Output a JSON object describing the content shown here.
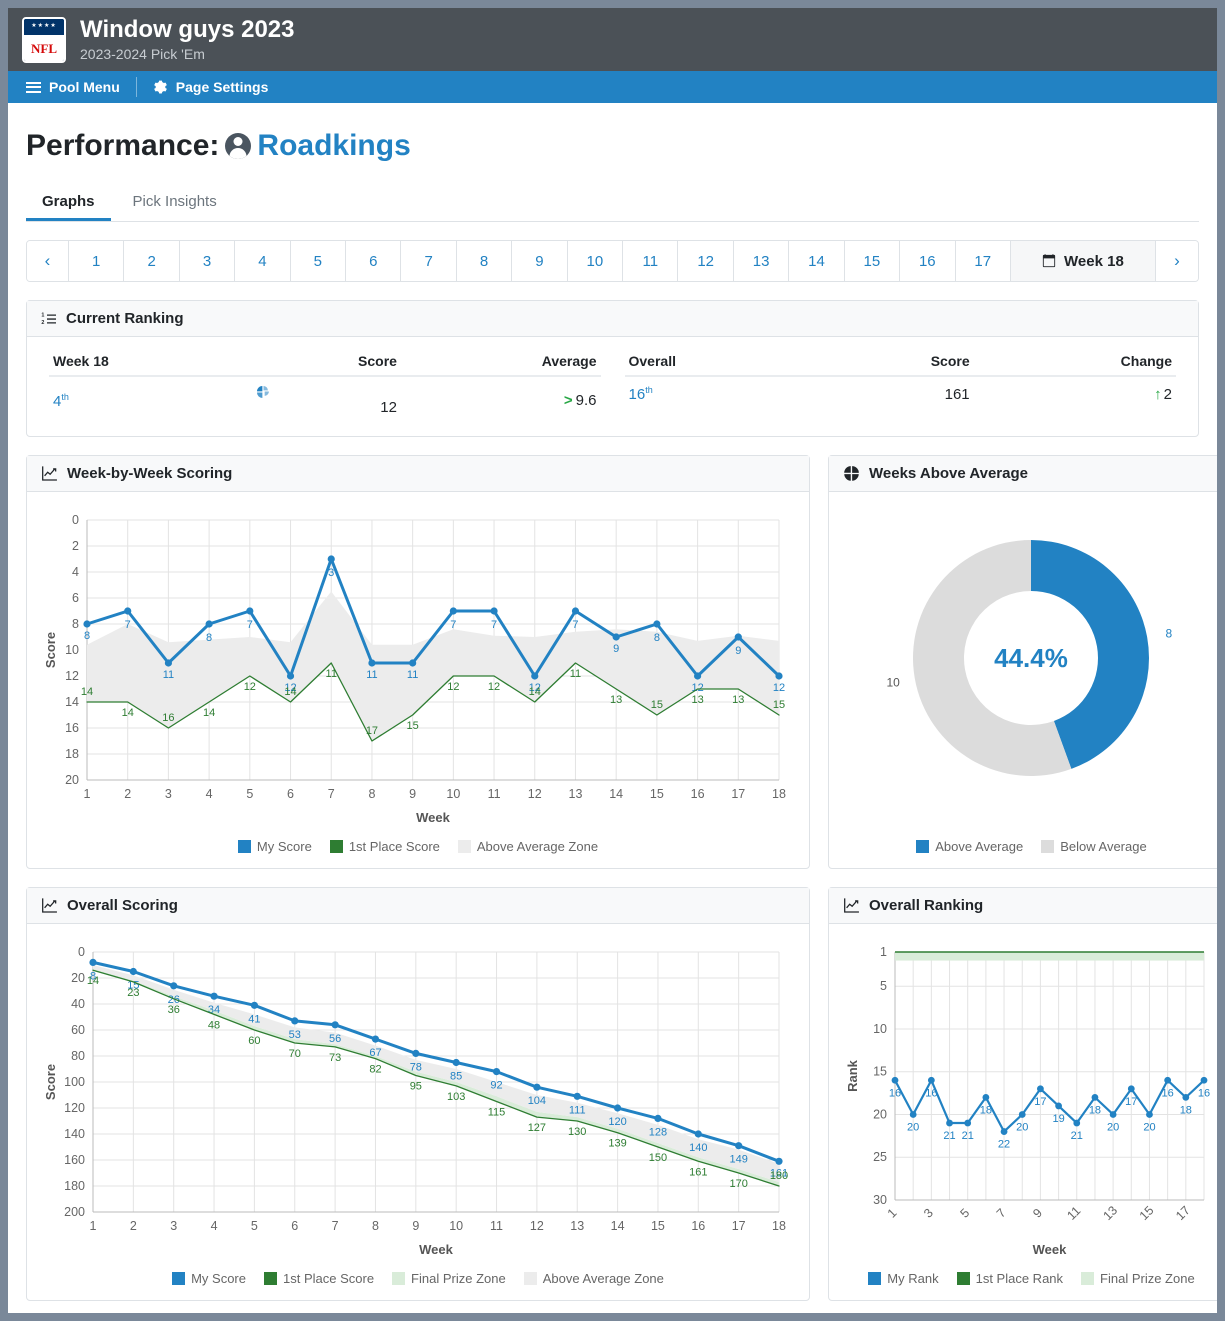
{
  "header": {
    "logo_alt": "NFL",
    "logo_stars": "★★★★",
    "logo_text": "NFL",
    "title": "Window guys 2023",
    "subtitle": "2023-2024 Pick 'Em",
    "menu": {
      "pool_menu": "Pool Menu",
      "page_settings": "Page Settings"
    }
  },
  "page": {
    "heading_prefix": "Performance:",
    "username": "Roadkings"
  },
  "tabs": [
    {
      "label": "Graphs",
      "active": true
    },
    {
      "label": "Pick Insights",
      "active": false
    }
  ],
  "pager": {
    "prev": "‹",
    "next": "›",
    "weeks": [
      "1",
      "2",
      "3",
      "4",
      "5",
      "6",
      "7",
      "8",
      "9",
      "10",
      "11",
      "12",
      "13",
      "14",
      "15",
      "16",
      "17"
    ],
    "current": "Week 18"
  },
  "current_ranking": {
    "panel_title": "Current Ranking",
    "left": {
      "header_label": "Week 18",
      "header_score": "Score",
      "header_average": "Average",
      "rank": "4",
      "rank_suffix": "th",
      "score": "12",
      "average": "9.6"
    },
    "right": {
      "header_label": "Overall",
      "header_score": "Score",
      "header_change": "Change",
      "rank": "16",
      "rank_suffix": "th",
      "score": "161",
      "change": "2",
      "change_direction": "up"
    }
  },
  "panels": {
    "week_by_week": "Week-by-Week Scoring",
    "weeks_above_average": "Weeks Above Average",
    "overall_scoring": "Overall Scoring",
    "overall_ranking": "Overall Ranking"
  },
  "colors": {
    "blue": "#2282c3",
    "green": "#2e7d32",
    "green_zone": "#d9ecd9",
    "gray_zone": "#ececec",
    "donut_gray": "#dcdcdc",
    "nav_blue": "#2282c3"
  },
  "chart_data": [
    {
      "id": "week_by_week",
      "type": "line",
      "title": "Week-by-Week Scoring",
      "xlabel": "Week",
      "ylabel": "Score",
      "xlim": [
        1,
        18
      ],
      "ylim": [
        0,
        20
      ],
      "yticks": [
        0,
        2,
        4,
        6,
        8,
        10,
        12,
        14,
        16,
        18,
        20
      ],
      "categories": [
        1,
        2,
        3,
        4,
        5,
        6,
        7,
        8,
        9,
        10,
        11,
        12,
        13,
        14,
        15,
        16,
        17,
        18
      ],
      "grid": true,
      "legend_position": "bottom",
      "series": [
        {
          "name": "My Score",
          "color": "#2282c3",
          "values": [
            8,
            7,
            11,
            8,
            7,
            12,
            3,
            11,
            11,
            7,
            7,
            12,
            7,
            9,
            8,
            12,
            9,
            12
          ]
        },
        {
          "name": "1st Place Score",
          "color": "#2e7d32",
          "values": [
            14,
            14,
            16,
            14,
            12,
            14,
            11,
            17,
            15,
            12,
            12,
            14,
            11,
            13,
            15,
            13,
            13,
            15
          ]
        },
        {
          "name": "Above Average Zone",
          "color": "#ececec",
          "kind": "band",
          "values": [
            9.6,
            8,
            9.4,
            9.2,
            9.0,
            9.4,
            5.5,
            9.6,
            9.6,
            8.4,
            8.9,
            9.0,
            8.6,
            8.4,
            8.6,
            9.3,
            8.9,
            9.3
          ]
        }
      ]
    },
    {
      "id": "weeks_above_average",
      "type": "pie",
      "title": "Weeks Above Average",
      "center_label": "44.4%",
      "legend_position": "bottom",
      "labels": [
        "Above Average",
        "Below Average"
      ],
      "values": [
        8,
        10
      ],
      "colors": [
        "#2282c3",
        "#dcdcdc"
      ]
    },
    {
      "id": "overall_scoring",
      "type": "line",
      "title": "Overall Scoring",
      "xlabel": "Week",
      "ylabel": "Score",
      "xlim": [
        1,
        18
      ],
      "ylim": [
        0,
        200
      ],
      "yticks": [
        0,
        20,
        40,
        60,
        80,
        100,
        120,
        140,
        160,
        180,
        200
      ],
      "categories": [
        1,
        2,
        3,
        4,
        5,
        6,
        7,
        8,
        9,
        10,
        11,
        12,
        13,
        14,
        15,
        16,
        17,
        18
      ],
      "grid": true,
      "legend_position": "bottom",
      "series": [
        {
          "name": "My Score",
          "color": "#2282c3",
          "values": [
            8,
            15,
            26,
            34,
            41,
            53,
            56,
            67,
            78,
            85,
            92,
            104,
            111,
            120,
            128,
            140,
            149,
            161
          ]
        },
        {
          "name": "1st Place Score",
          "color": "#2e7d32",
          "values": [
            14,
            23,
            36,
            48,
            60,
            70,
            73,
            82,
            95,
            103,
            115,
            127,
            130,
            139,
            150,
            161,
            170,
            180
          ]
        },
        {
          "name": "Final Prize Zone",
          "color": "#d9ecd9",
          "kind": "band",
          "values": [
            13,
            22,
            34,
            45,
            57,
            67,
            71,
            80,
            92,
            100,
            111,
            123,
            127,
            136,
            147,
            158,
            167,
            177
          ]
        },
        {
          "name": "Above Average Zone",
          "color": "#ececec",
          "kind": "band",
          "values": [
            10,
            18,
            29,
            39,
            48,
            58,
            62,
            72,
            83,
            90,
            100,
            110,
            116,
            124,
            133,
            144,
            152,
            163
          ]
        }
      ]
    },
    {
      "id": "overall_ranking",
      "type": "line",
      "title": "Overall Ranking",
      "xlabel": "Week",
      "ylabel": "Rank",
      "xlim": [
        1,
        18
      ],
      "ylim": [
        30,
        1
      ],
      "yticks": [
        1,
        5,
        10,
        15,
        20,
        25,
        30
      ],
      "xticks": [
        1,
        3,
        5,
        7,
        9,
        11,
        13,
        15,
        17
      ],
      "categories": [
        1,
        2,
        3,
        4,
        5,
        6,
        7,
        8,
        9,
        10,
        11,
        12,
        13,
        14,
        15,
        16,
        17,
        18
      ],
      "grid": true,
      "legend_position": "bottom",
      "series": [
        {
          "name": "My Rank",
          "color": "#2282c3",
          "values": [
            16,
            20,
            16,
            21,
            21,
            18,
            22,
            20,
            17,
            19,
            21,
            18,
            20,
            17,
            20,
            16,
            18,
            16
          ]
        },
        {
          "name": "1st Place Rank",
          "color": "#2e7d32",
          "values": [
            1,
            1,
            1,
            1,
            1,
            1,
            1,
            1,
            1,
            1,
            1,
            1,
            1,
            1,
            1,
            1,
            1,
            1
          ]
        },
        {
          "name": "Final Prize Zone",
          "color": "#d9ecd9",
          "kind": "band",
          "values": [
            2,
            2,
            2,
            2,
            2,
            2,
            2,
            2,
            2,
            2,
            2,
            2,
            2,
            2,
            2,
            2,
            2,
            2
          ]
        }
      ]
    }
  ],
  "legends": {
    "week_by_week": [
      "My Score",
      "1st Place Score",
      "Above Average Zone"
    ],
    "donut": [
      "Above Average",
      "Below Average"
    ],
    "overall_scoring": [
      "My Score",
      "1st Place Score",
      "Final Prize Zone",
      "Above Average Zone"
    ],
    "overall_ranking": [
      "My Rank",
      "1st Place Rank",
      "Final Prize Zone"
    ]
  }
}
